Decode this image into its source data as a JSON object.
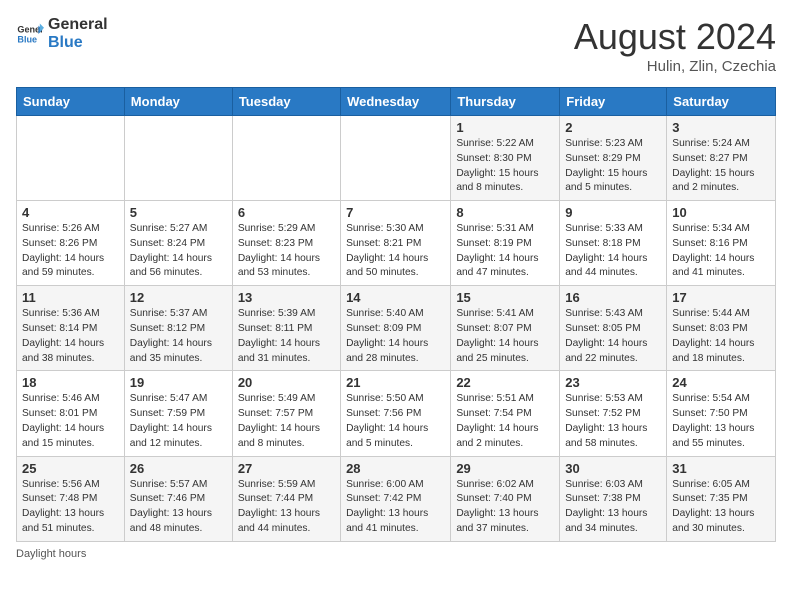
{
  "header": {
    "logo_general": "General",
    "logo_blue": "Blue",
    "month_year": "August 2024",
    "location": "Hulin, Zlin, Czechia"
  },
  "weekdays": [
    "Sunday",
    "Monday",
    "Tuesday",
    "Wednesday",
    "Thursday",
    "Friday",
    "Saturday"
  ],
  "weeks": [
    [
      {
        "day": "",
        "info": ""
      },
      {
        "day": "",
        "info": ""
      },
      {
        "day": "",
        "info": ""
      },
      {
        "day": "",
        "info": ""
      },
      {
        "day": "1",
        "info": "Sunrise: 5:22 AM\nSunset: 8:30 PM\nDaylight: 15 hours and 8 minutes."
      },
      {
        "day": "2",
        "info": "Sunrise: 5:23 AM\nSunset: 8:29 PM\nDaylight: 15 hours and 5 minutes."
      },
      {
        "day": "3",
        "info": "Sunrise: 5:24 AM\nSunset: 8:27 PM\nDaylight: 15 hours and 2 minutes."
      }
    ],
    [
      {
        "day": "4",
        "info": "Sunrise: 5:26 AM\nSunset: 8:26 PM\nDaylight: 14 hours and 59 minutes."
      },
      {
        "day": "5",
        "info": "Sunrise: 5:27 AM\nSunset: 8:24 PM\nDaylight: 14 hours and 56 minutes."
      },
      {
        "day": "6",
        "info": "Sunrise: 5:29 AM\nSunset: 8:23 PM\nDaylight: 14 hours and 53 minutes."
      },
      {
        "day": "7",
        "info": "Sunrise: 5:30 AM\nSunset: 8:21 PM\nDaylight: 14 hours and 50 minutes."
      },
      {
        "day": "8",
        "info": "Sunrise: 5:31 AM\nSunset: 8:19 PM\nDaylight: 14 hours and 47 minutes."
      },
      {
        "day": "9",
        "info": "Sunrise: 5:33 AM\nSunset: 8:18 PM\nDaylight: 14 hours and 44 minutes."
      },
      {
        "day": "10",
        "info": "Sunrise: 5:34 AM\nSunset: 8:16 PM\nDaylight: 14 hours and 41 minutes."
      }
    ],
    [
      {
        "day": "11",
        "info": "Sunrise: 5:36 AM\nSunset: 8:14 PM\nDaylight: 14 hours and 38 minutes."
      },
      {
        "day": "12",
        "info": "Sunrise: 5:37 AM\nSunset: 8:12 PM\nDaylight: 14 hours and 35 minutes."
      },
      {
        "day": "13",
        "info": "Sunrise: 5:39 AM\nSunset: 8:11 PM\nDaylight: 14 hours and 31 minutes."
      },
      {
        "day": "14",
        "info": "Sunrise: 5:40 AM\nSunset: 8:09 PM\nDaylight: 14 hours and 28 minutes."
      },
      {
        "day": "15",
        "info": "Sunrise: 5:41 AM\nSunset: 8:07 PM\nDaylight: 14 hours and 25 minutes."
      },
      {
        "day": "16",
        "info": "Sunrise: 5:43 AM\nSunset: 8:05 PM\nDaylight: 14 hours and 22 minutes."
      },
      {
        "day": "17",
        "info": "Sunrise: 5:44 AM\nSunset: 8:03 PM\nDaylight: 14 hours and 18 minutes."
      }
    ],
    [
      {
        "day": "18",
        "info": "Sunrise: 5:46 AM\nSunset: 8:01 PM\nDaylight: 14 hours and 15 minutes."
      },
      {
        "day": "19",
        "info": "Sunrise: 5:47 AM\nSunset: 7:59 PM\nDaylight: 14 hours and 12 minutes."
      },
      {
        "day": "20",
        "info": "Sunrise: 5:49 AM\nSunset: 7:57 PM\nDaylight: 14 hours and 8 minutes."
      },
      {
        "day": "21",
        "info": "Sunrise: 5:50 AM\nSunset: 7:56 PM\nDaylight: 14 hours and 5 minutes."
      },
      {
        "day": "22",
        "info": "Sunrise: 5:51 AM\nSunset: 7:54 PM\nDaylight: 14 hours and 2 minutes."
      },
      {
        "day": "23",
        "info": "Sunrise: 5:53 AM\nSunset: 7:52 PM\nDaylight: 13 hours and 58 minutes."
      },
      {
        "day": "24",
        "info": "Sunrise: 5:54 AM\nSunset: 7:50 PM\nDaylight: 13 hours and 55 minutes."
      }
    ],
    [
      {
        "day": "25",
        "info": "Sunrise: 5:56 AM\nSunset: 7:48 PM\nDaylight: 13 hours and 51 minutes."
      },
      {
        "day": "26",
        "info": "Sunrise: 5:57 AM\nSunset: 7:46 PM\nDaylight: 13 hours and 48 minutes."
      },
      {
        "day": "27",
        "info": "Sunrise: 5:59 AM\nSunset: 7:44 PM\nDaylight: 13 hours and 44 minutes."
      },
      {
        "day": "28",
        "info": "Sunrise: 6:00 AM\nSunset: 7:42 PM\nDaylight: 13 hours and 41 minutes."
      },
      {
        "day": "29",
        "info": "Sunrise: 6:02 AM\nSunset: 7:40 PM\nDaylight: 13 hours and 37 minutes."
      },
      {
        "day": "30",
        "info": "Sunrise: 6:03 AM\nSunset: 7:38 PM\nDaylight: 13 hours and 34 minutes."
      },
      {
        "day": "31",
        "info": "Sunrise: 6:05 AM\nSunset: 7:35 PM\nDaylight: 13 hours and 30 minutes."
      }
    ]
  ],
  "footer": {
    "daylight_hours": "Daylight hours"
  }
}
